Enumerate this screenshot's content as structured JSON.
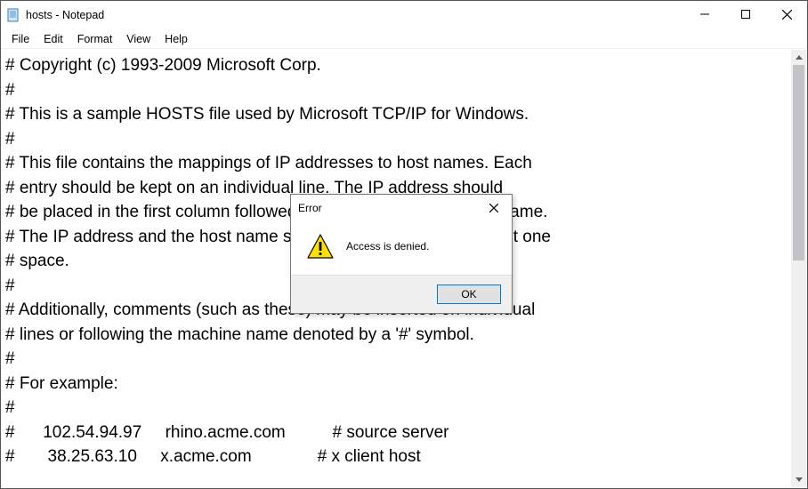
{
  "window": {
    "title": "hosts - Notepad"
  },
  "menubar": {
    "items": [
      "File",
      "Edit",
      "Format",
      "View",
      "Help"
    ]
  },
  "editor": {
    "content": "# Copyright (c) 1993-2009 Microsoft Corp.\n#\n# This is a sample HOSTS file used by Microsoft TCP/IP for Windows.\n#\n# This file contains the mappings of IP addresses to host names. Each\n# entry should be kept on an individual line. The IP address should\n# be placed in the first column followed by the corresponding host name.\n# The IP address and the host name should be separated by at least one\n# space.\n#\n# Additionally, comments (such as these) may be inserted on individual\n# lines or following the machine name denoted by a '#' symbol.\n#\n# For example:\n#\n#      102.54.94.97     rhino.acme.com          # source server\n#       38.25.63.10     x.acme.com              # x client host"
  },
  "dialog": {
    "title": "Error",
    "message": "Access is denied.",
    "ok_label": "OK"
  }
}
